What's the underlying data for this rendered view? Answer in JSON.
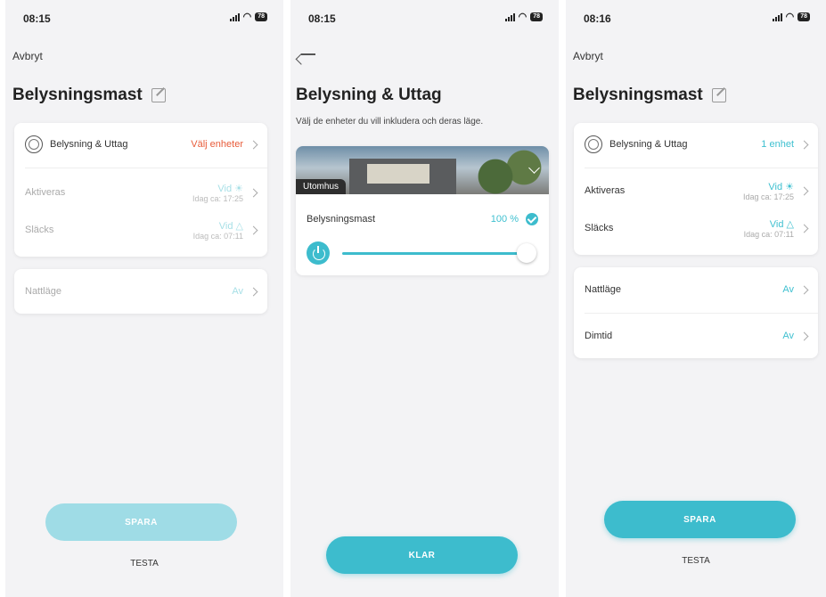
{
  "screen1": {
    "time": "08:15",
    "battery": "78",
    "cancel": "Avbryt",
    "title": "Belysningsmast",
    "lighting": {
      "label": "Belysning & Uttag",
      "value": "Välj enheter"
    },
    "on": {
      "label": "Aktiveras",
      "value": "Vid",
      "sub": "Idag ca: 17:25"
    },
    "off": {
      "label": "Släcks",
      "value": "Vid",
      "sub": "Idag ca: 07:11"
    },
    "night": {
      "label": "Nattläge",
      "value": "Av"
    },
    "save": "SPARA",
    "test": "TESTA"
  },
  "screen2": {
    "time": "08:15",
    "battery": "78",
    "title": "Belysning & Uttag",
    "description": "Välj de enheter du vill inkludera och deras läge.",
    "group": "Utomhus",
    "device": {
      "label": "Belysningsmast",
      "value": "100 %",
      "level": 1.0
    },
    "done": "KLAR"
  },
  "screen3": {
    "time": "08:16",
    "battery": "78",
    "cancel": "Avbryt",
    "title": "Belysningsmast",
    "lighting": {
      "label": "Belysning & Uttag",
      "value": "1 enhet"
    },
    "on": {
      "label": "Aktiveras",
      "value": "Vid",
      "sub": "Idag ca: 17:25"
    },
    "off": {
      "label": "Släcks",
      "value": "Vid",
      "sub": "Idag ca: 07:11"
    },
    "night": {
      "label": "Nattläge",
      "value": "Av"
    },
    "dim": {
      "label": "Dimtid",
      "value": "Av"
    },
    "save": "SPARA",
    "test": "TESTA"
  },
  "colors": {
    "accent": "#3dbccd",
    "warning": "#e85c3a"
  }
}
